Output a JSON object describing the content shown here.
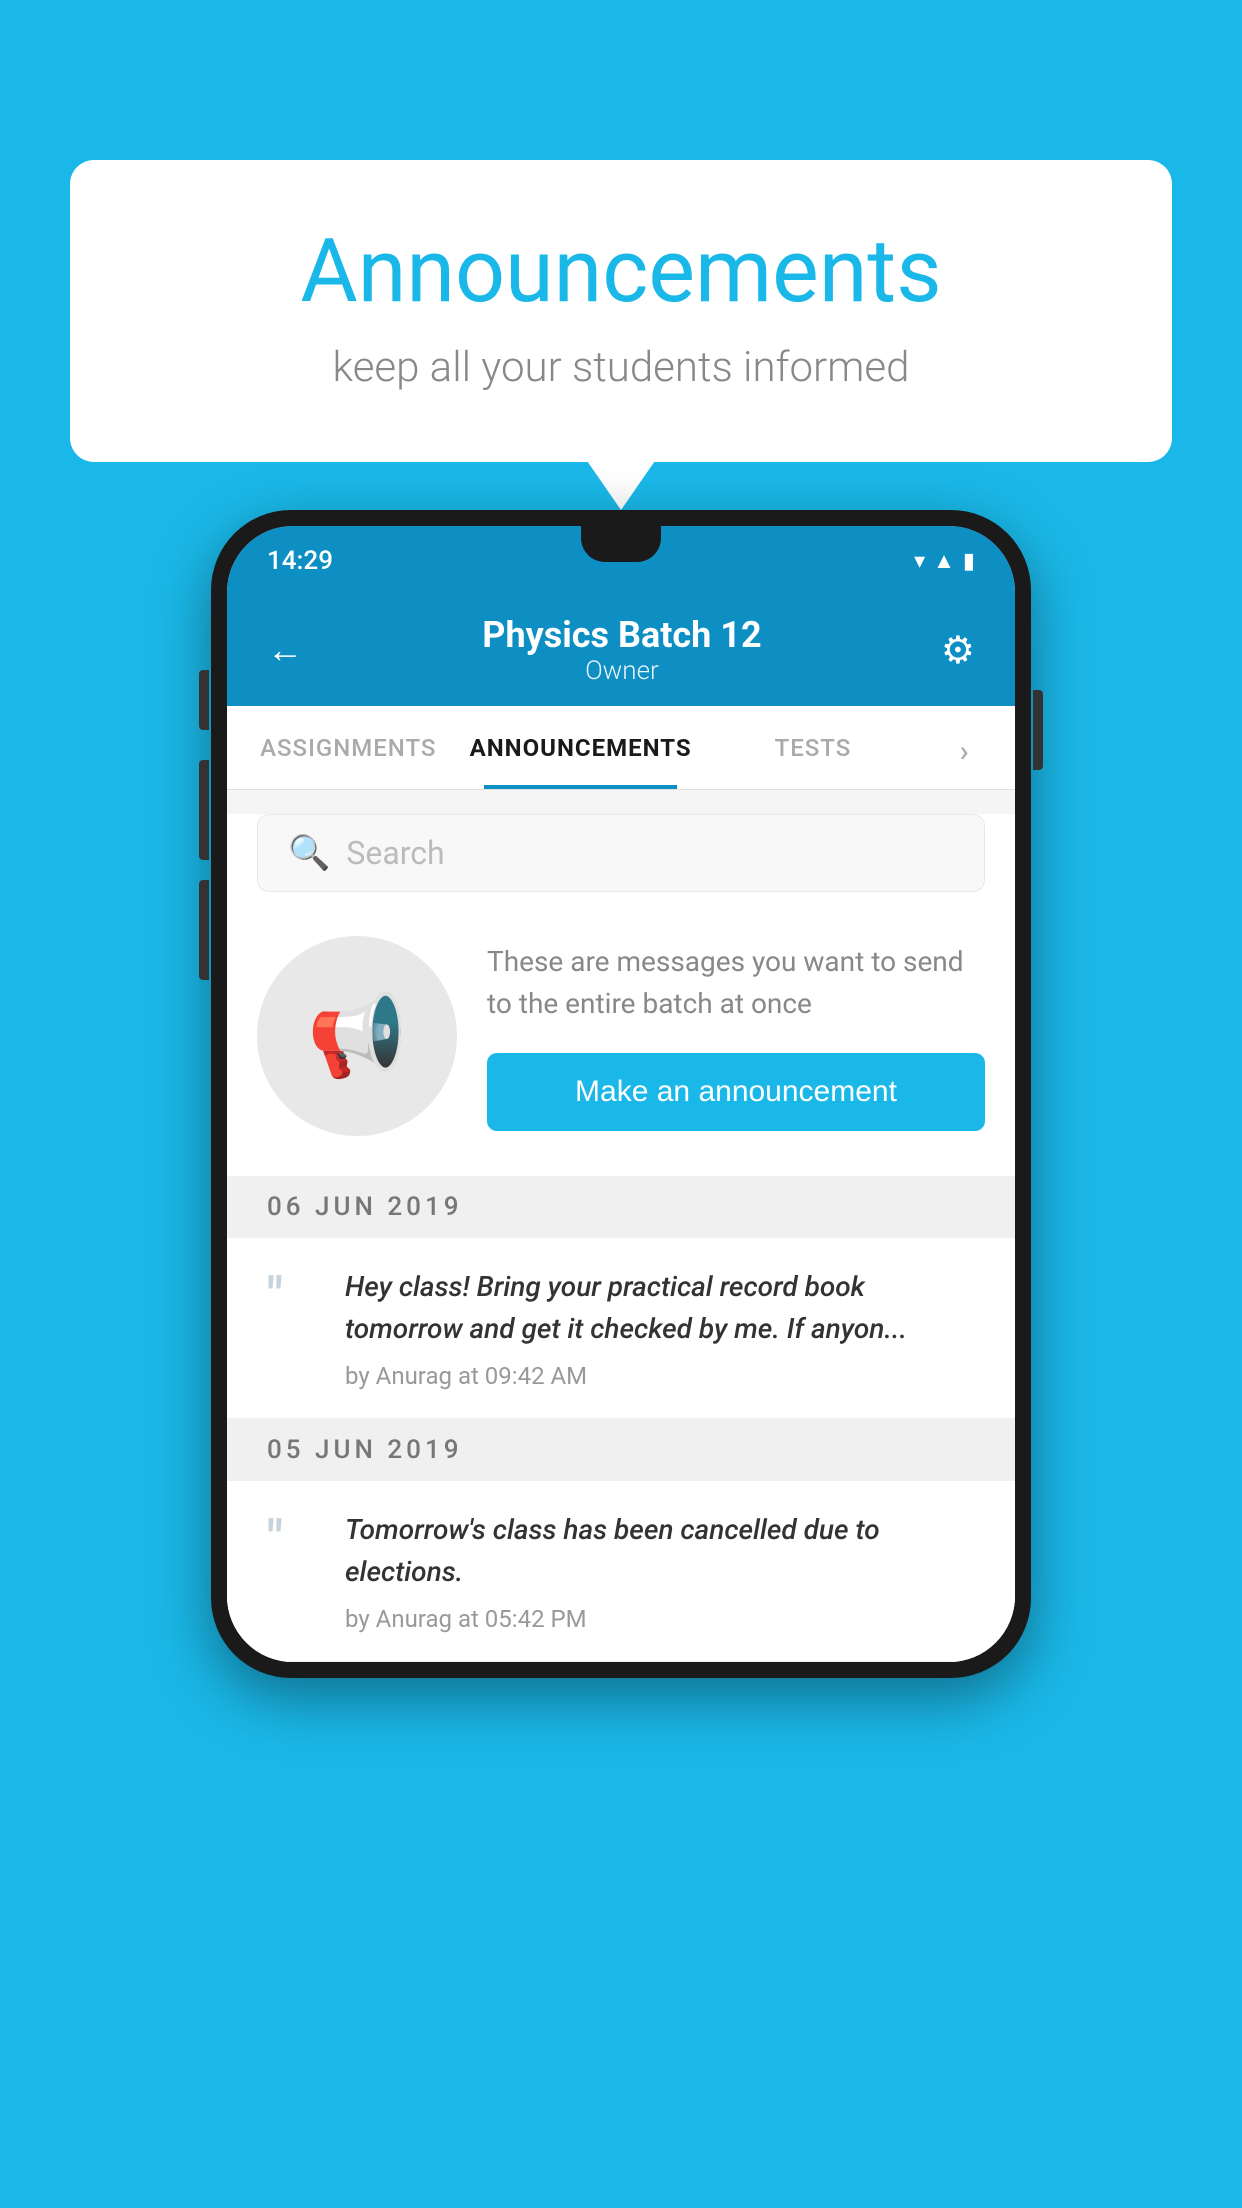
{
  "background_color": "#1ab8e8",
  "speech_bubble": {
    "title": "Announcements",
    "subtitle": "keep all your students informed"
  },
  "phone": {
    "status_bar": {
      "time": "14:29",
      "icons": [
        "wifi",
        "signal",
        "battery"
      ]
    },
    "header": {
      "back_label": "←",
      "title": "Physics Batch 12",
      "subtitle": "Owner",
      "gear_icon": "⚙"
    },
    "tabs": [
      {
        "label": "ASSIGNMENTS",
        "active": false
      },
      {
        "label": "ANNOUNCEMENTS",
        "active": true
      },
      {
        "label": "TESTS",
        "active": false
      },
      {
        "label": "›",
        "active": false
      }
    ],
    "search": {
      "placeholder": "Search"
    },
    "announcement_intro": {
      "description": "These are messages you want to send to the entire batch at once",
      "button_label": "Make an announcement"
    },
    "date_groups": [
      {
        "date": "06  JUN  2019",
        "items": [
          {
            "text": "Hey class! Bring your practical record book tomorrow and get it checked by me. If anyon...",
            "meta": "by Anurag at 09:42 AM"
          }
        ]
      },
      {
        "date": "05  JUN  2019",
        "items": [
          {
            "text": "Tomorrow's class has been cancelled due to elections.",
            "meta": "by Anurag at 05:42 PM"
          }
        ]
      }
    ]
  }
}
